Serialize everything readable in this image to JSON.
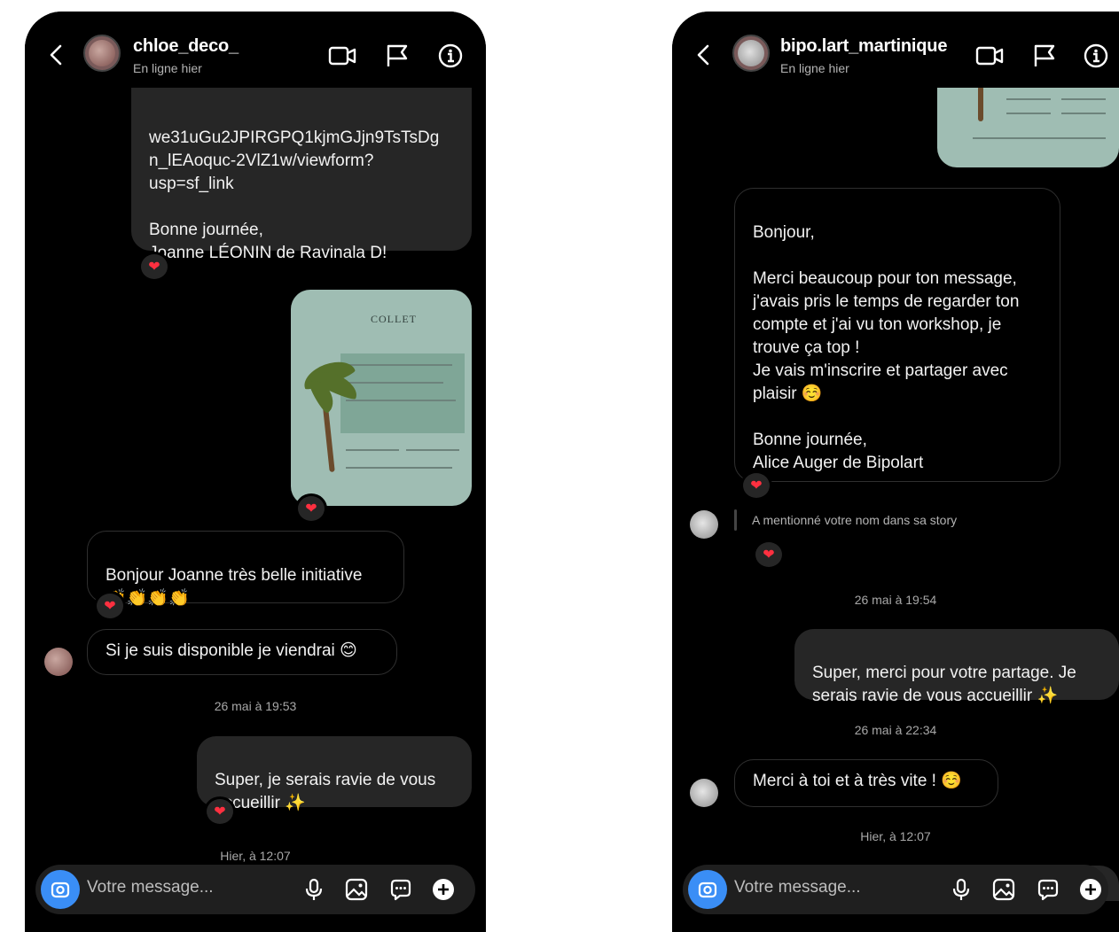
{
  "left": {
    "header": {
      "username": "chloe_deco_",
      "status": "En ligne hier"
    },
    "messages": {
      "link_text": "we31uGu2JPIRGPQ1kjmGJjn9TsTsDg\nn_lEAoquc-2VlZ1w/viewform?\nusp=sf_link",
      "signoff": "Bonne journée,\nJoanne LÉONIN de Ravinala D!",
      "poster_title": "COLLET",
      "msg_bonjour": "Bonjour Joanne très belle initiative\n👏👏👏👏",
      "msg_dispo": "Si je suis disponible je viendrai 😊",
      "time1": "26 mai à 19:53",
      "msg_super": "Super, je serais ravie de vous\naccueillir ✨",
      "time2": "Hier, à 12:07"
    },
    "composer": {
      "placeholder": "Votre message..."
    }
  },
  "right": {
    "header": {
      "username": "bipo.lart_martinique",
      "status": "En ligne hier"
    },
    "messages": {
      "msg_long": "Bonjour,\n\nMerci beaucoup pour ton message,\nj'avais pris le temps de regarder ton\ncompte et j'ai vu ton workshop, je\ntrouve ça top !\nJe vais m'inscrire et partager avec\nplaisir ☺️\n\nBonne journée,\nAlice Auger de Bipolart",
      "mention": "A mentionné votre nom dans sa story",
      "time1": "26 mai à 19:54",
      "msg_super": "Super, merci pour votre partage. Je\nserais ravie de vous accueillir ✨",
      "time2": "26 mai à 22:34",
      "msg_merci": "Merci à toi et à très vite ! ☺️",
      "time3": "Hier, à 12:07"
    },
    "composer": {
      "placeholder": "Votre message..."
    }
  },
  "icons": {
    "back": "chevron-left-icon",
    "video": "video-camera-icon",
    "flag": "flag-icon",
    "info": "info-icon",
    "camera": "camera-icon",
    "mic": "microphone-icon",
    "gallery": "image-icon",
    "sticker": "sticker-icon",
    "plus": "plus-icon",
    "heart": "heart-icon"
  },
  "colors": {
    "background": "#000000",
    "bubble_out": "#262626",
    "bubble_in_border": "#2f2f2f",
    "camera_button": "#3a8ef6",
    "heart": "#ff3040",
    "poster": "#9fbdb3"
  }
}
